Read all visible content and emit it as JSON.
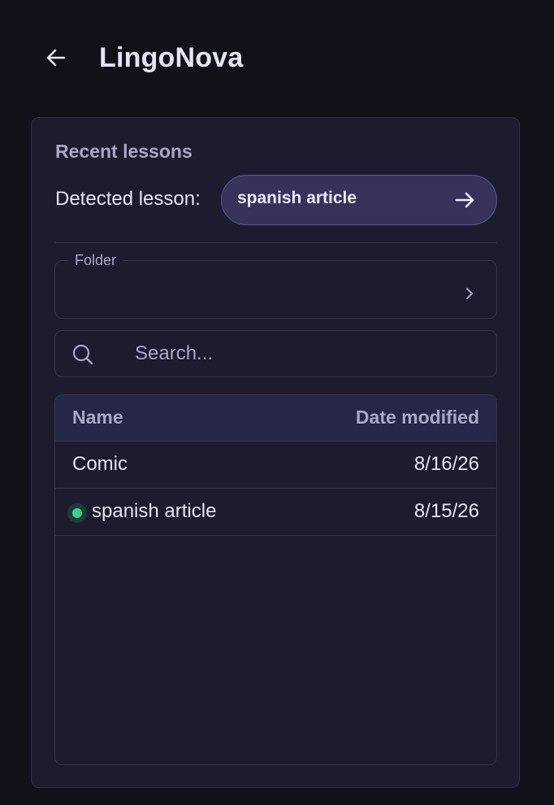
{
  "header": {
    "title": "LingoNova",
    "back_icon": "arrow-left-icon"
  },
  "panel": {
    "title": "Recent lessons",
    "detected": {
      "label": "Detected lesson:",
      "lesson_name": "spanish article",
      "icon": "arrow-right-icon"
    },
    "folder": {
      "label": "Folder",
      "value": "",
      "icon": "chevron-right-icon"
    },
    "search": {
      "placeholder": "Search...",
      "value": "",
      "icon": "search-icon"
    },
    "table": {
      "columns": {
        "name": "Name",
        "date": "Date modified"
      },
      "rows": [
        {
          "name": "Comic",
          "date": "8/16/26",
          "active": false
        },
        {
          "name": "spanish article",
          "date": "8/15/26",
          "active": true
        }
      ]
    }
  },
  "colors": {
    "background": "#11111a",
    "panel": "#1c1c2e",
    "accent": "#38325a",
    "active_dot": "#3ecf8e"
  }
}
